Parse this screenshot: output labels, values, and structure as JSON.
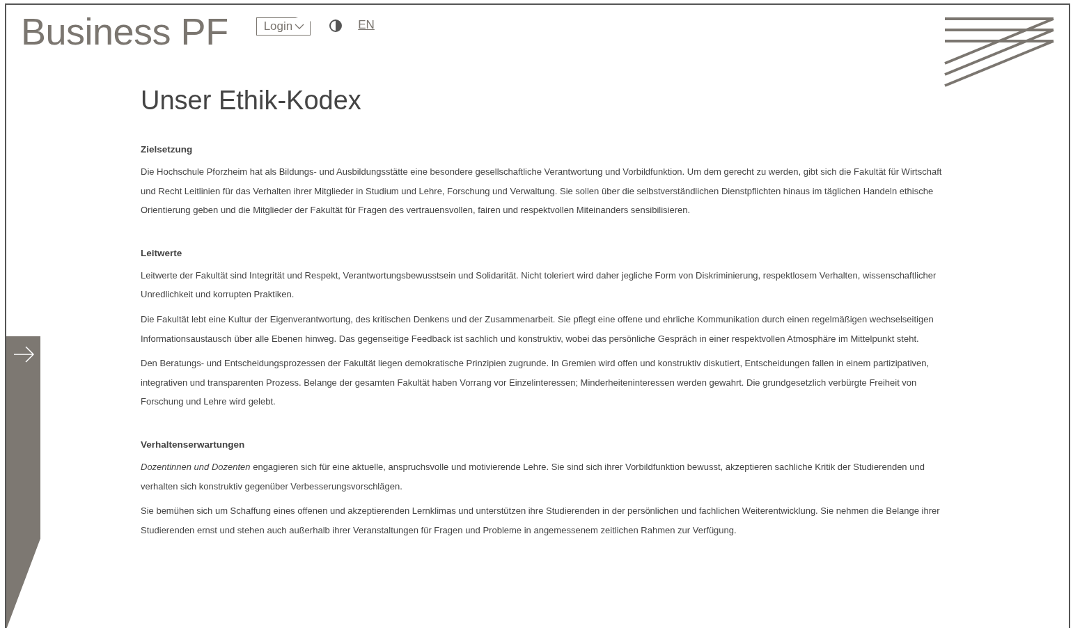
{
  "header": {
    "logo": "Business PF",
    "login": "Login",
    "language": "EN"
  },
  "title": "Unser Ethik-Kodex",
  "sections": [
    {
      "heading": "Zielsetzung",
      "paragraphs": [
        "Die Hochschule Pforzheim hat als Bildungs- und Ausbildungsstätte eine besondere gesellschaftliche Verantwortung und Vorbildfunktion. Um dem gerecht zu werden, gibt sich die Fakultät für Wirtschaft und Recht Leitlinien für das Verhalten ihrer Mitglieder in Studium und Lehre, Forschung und Verwaltung. Sie sollen über die selbstverständlichen Dienstpflichten hinaus im täglichen Handeln ethische Orientierung geben und die Mitglieder der Fakultät für Fragen des vertrauensvollen, fairen und respektvollen Miteinanders sensibilisieren."
      ]
    },
    {
      "heading": "Leitwerte",
      "paragraphs": [
        "Leitwerte der Fakultät sind Integrität und Respekt, Verantwortungsbewusstsein und Solidarität. Nicht toleriert wird daher jegliche Form von Diskriminierung, respektlosem Verhalten, wissenschaftlicher Unredlichkeit und korrupten Praktiken.",
        "Die Fakultät lebt eine Kultur der Eigenverantwortung, des kritischen Denkens und der Zusammenarbeit. Sie pflegt eine offene und ehrliche Kommunikation durch einen regelmäßigen wechselseitigen Informationsaustausch über alle Ebenen hinweg. Das gegenseitige Feedback ist sachlich und konstruktiv, wobei das persönliche Gespräch in einer respektvollen Atmosphäre im Mittelpunkt steht.",
        "Den Beratungs- und Entscheidungsprozessen der Fakultät liegen demokratische Prinzipien zugrunde. In Gremien wird offen und konstruktiv diskutiert, Entscheidungen fallen in einem partizipativen, integrativen und transparenten Prozess. Belange der gesamten Fakultät haben Vorrang vor Einzelinteressen; Minderheiteninteressen werden gewahrt. Die grundgesetzlich verbürgte Freiheit von Forschung und Lehre wird gelebt."
      ]
    },
    {
      "heading": "Verhaltenserwartungen",
      "paragraphs": [
        "*Dozentinnen und Dozenten* engagieren sich für eine aktuelle, anspruchsvolle und motivierende Lehre. Sie sind sich ihrer Vorbildfunktion bewusst, akzeptieren sachliche Kritik der Studierenden und verhalten sich konstruktiv gegenüber Verbesserungsvorschlägen.",
        "Sie bemühen sich um Schaffung eines offenen und akzeptierenden Lernklimas und unterstützen ihre Studierenden in der persönlichen und fachlichen Weiterentwicklung. Sie nehmen die Belange ihrer Studierenden ernst und stehen auch außerhalb ihrer Veranstaltungen für Fragen und Probleme in angemessenem zeitlichen Rahmen zur Verfügung."
      ]
    }
  ]
}
